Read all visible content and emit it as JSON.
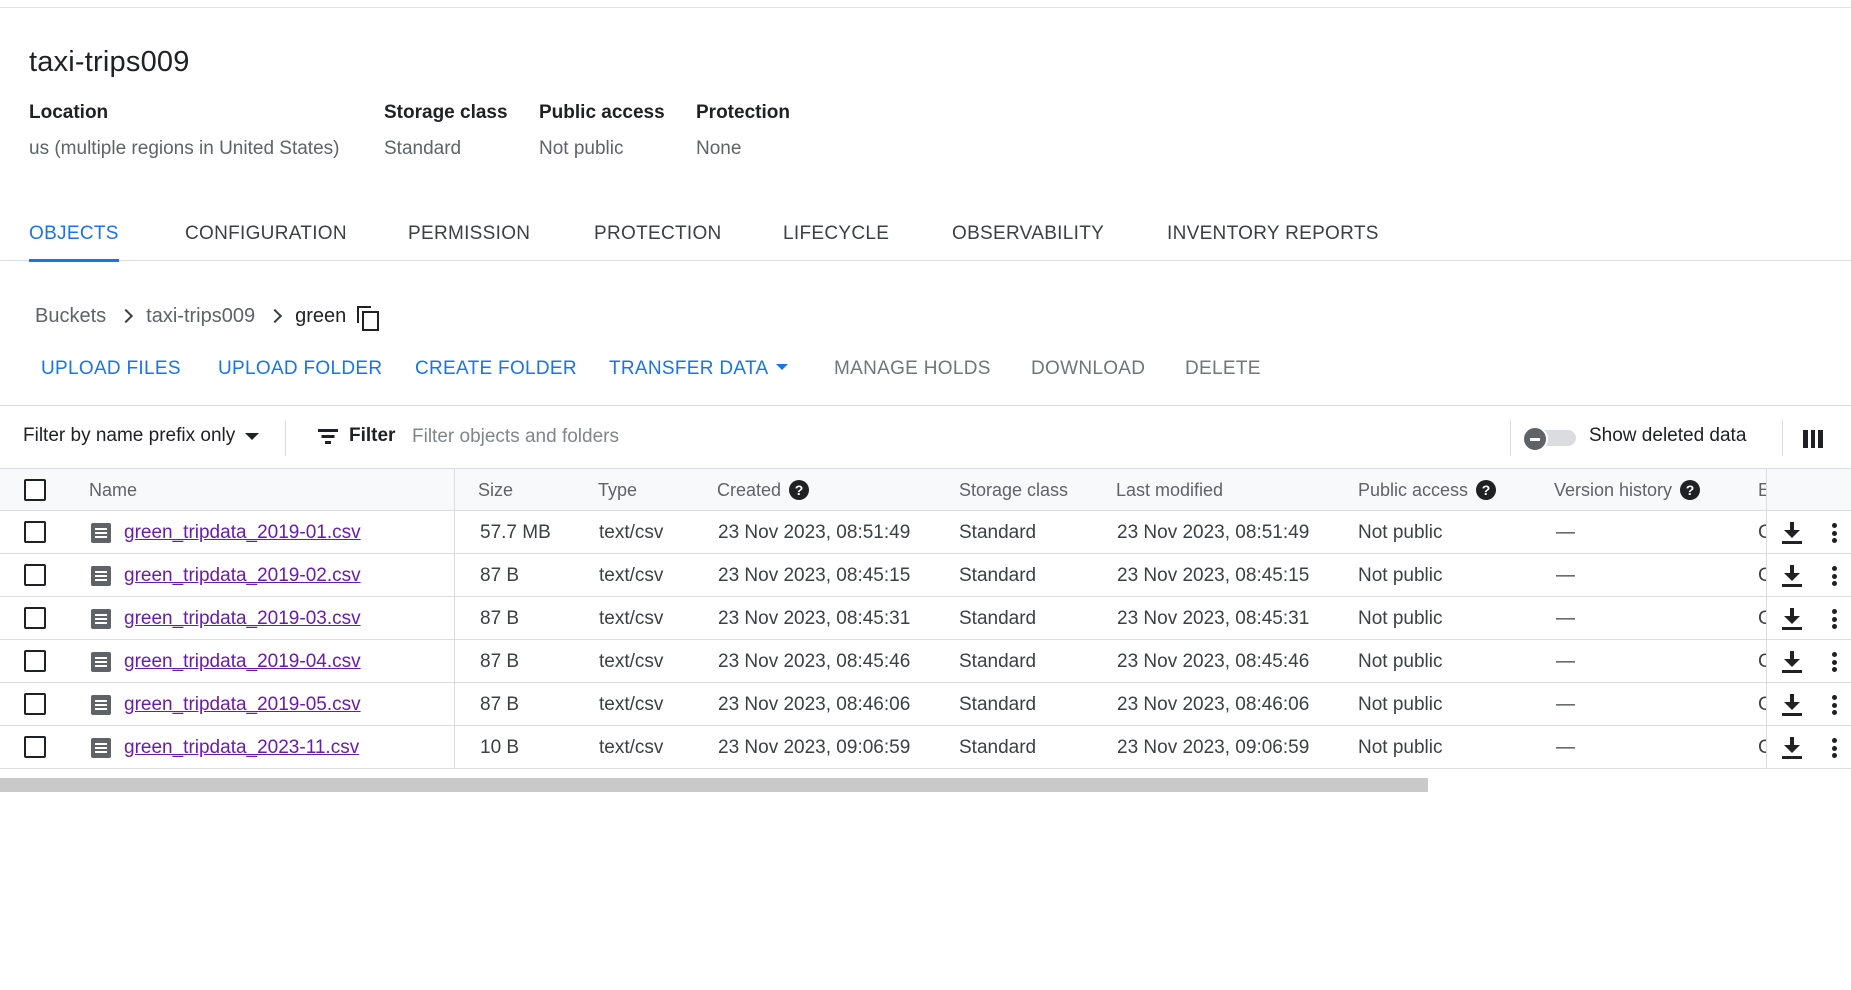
{
  "bucket": {
    "title": "taxi-trips009",
    "meta": [
      {
        "label": "Location",
        "value": "us (multiple regions in United States)"
      },
      {
        "label": "Storage class",
        "value": "Standard"
      },
      {
        "label": "Public access",
        "value": "Not public"
      },
      {
        "label": "Protection",
        "value": "None"
      }
    ]
  },
  "tabs": [
    "OBJECTS",
    "CONFIGURATION",
    "PERMISSION",
    "PROTECTION",
    "LIFECYCLE",
    "OBSERVABILITY",
    "INVENTORY REPORTS"
  ],
  "active_tab": "OBJECTS",
  "breadcrumb": {
    "items": [
      "Buckets",
      "taxi-trips009"
    ],
    "current": "green"
  },
  "actions": {
    "upload_files": "UPLOAD FILES",
    "upload_folder": "UPLOAD FOLDER",
    "create_folder": "CREATE FOLDER",
    "transfer_data": "TRANSFER DATA",
    "manage_holds": "MANAGE HOLDS",
    "download": "DOWNLOAD",
    "delete": "DELETE"
  },
  "filter": {
    "prefix_mode": "Filter by name prefix only",
    "filter_label": "Filter",
    "placeholder": "Filter objects and folders",
    "show_deleted_label": "Show deleted data"
  },
  "table": {
    "headers": {
      "name": "Name",
      "size": "Size",
      "type": "Type",
      "created": "Created",
      "storage_class": "Storage class",
      "last_modified": "Last modified",
      "public_access": "Public access",
      "version_history": "Version history",
      "cut_header": "E"
    },
    "rows": [
      {
        "name": "green_tripdata_2019-01.csv",
        "size": "57.7 MB",
        "type": "text/csv",
        "created": "23 Nov 2023, 08:51:49",
        "storage_class": "Standard",
        "last_modified": "23 Nov 2023, 08:51:49",
        "public_access": "Not public",
        "version_history": "—",
        "cut": "C"
      },
      {
        "name": "green_tripdata_2019-02.csv",
        "size": "87 B",
        "type": "text/csv",
        "created": "23 Nov 2023, 08:45:15",
        "storage_class": "Standard",
        "last_modified": "23 Nov 2023, 08:45:15",
        "public_access": "Not public",
        "version_history": "—",
        "cut": "C"
      },
      {
        "name": "green_tripdata_2019-03.csv",
        "size": "87 B",
        "type": "text/csv",
        "created": "23 Nov 2023, 08:45:31",
        "storage_class": "Standard",
        "last_modified": "23 Nov 2023, 08:45:31",
        "public_access": "Not public",
        "version_history": "—",
        "cut": "C"
      },
      {
        "name": "green_tripdata_2019-04.csv",
        "size": "87 B",
        "type": "text/csv",
        "created": "23 Nov 2023, 08:45:46",
        "storage_class": "Standard",
        "last_modified": "23 Nov 2023, 08:45:46",
        "public_access": "Not public",
        "version_history": "—",
        "cut": "C"
      },
      {
        "name": "green_tripdata_2019-05.csv",
        "size": "87 B",
        "type": "text/csv",
        "created": "23 Nov 2023, 08:46:06",
        "storage_class": "Standard",
        "last_modified": "23 Nov 2023, 08:46:06",
        "public_access": "Not public",
        "version_history": "—",
        "cut": "C"
      },
      {
        "name": "green_tripdata_2023-11.csv",
        "size": "10 B",
        "type": "text/csv",
        "created": "23 Nov 2023, 09:06:59",
        "storage_class": "Standard",
        "last_modified": "23 Nov 2023, 09:06:59",
        "public_access": "Not public",
        "version_history": "—",
        "cut": "C"
      }
    ]
  },
  "icons": {
    "copy": "copy-icon",
    "chevron": "chevron-right-icon",
    "filter": "filter-icon",
    "toggle": "toggle-switch",
    "columns": "column-display-icon",
    "help": "help-icon",
    "file": "file-icon",
    "download": "download-icon",
    "more": "more-vert-icon"
  },
  "colors": {
    "accent": "#1a73e8",
    "visited_link": "#681da8",
    "muted": "#5f6368"
  }
}
